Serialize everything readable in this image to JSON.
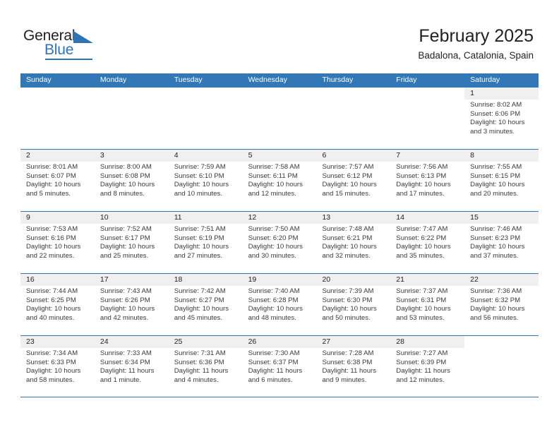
{
  "brand": {
    "name_part1": "General",
    "name_part2": "Blue",
    "triangle_icon": "triangle-icon",
    "accent_color": "#2e74b5"
  },
  "header": {
    "title": "February 2025",
    "subtitle": "Badalona, Catalonia, Spain"
  },
  "calendar": {
    "header_color": "#3278b6",
    "daynumber_band_color": "#f0f0f0",
    "day_names": [
      "Sunday",
      "Monday",
      "Tuesday",
      "Wednesday",
      "Thursday",
      "Friday",
      "Saturday"
    ],
    "weeks": [
      [
        {
          "day": "",
          "blank": true
        },
        {
          "day": "",
          "blank": true
        },
        {
          "day": "",
          "blank": true
        },
        {
          "day": "",
          "blank": true
        },
        {
          "day": "",
          "blank": true
        },
        {
          "day": "",
          "blank": true
        },
        {
          "day": "1",
          "sunrise": "Sunrise: 8:02 AM",
          "sunset": "Sunset: 6:06 PM",
          "daylight1": "Daylight: 10 hours",
          "daylight2": "and 3 minutes."
        }
      ],
      [
        {
          "day": "2",
          "sunrise": "Sunrise: 8:01 AM",
          "sunset": "Sunset: 6:07 PM",
          "daylight1": "Daylight: 10 hours",
          "daylight2": "and 5 minutes."
        },
        {
          "day": "3",
          "sunrise": "Sunrise: 8:00 AM",
          "sunset": "Sunset: 6:08 PM",
          "daylight1": "Daylight: 10 hours",
          "daylight2": "and 8 minutes."
        },
        {
          "day": "4",
          "sunrise": "Sunrise: 7:59 AM",
          "sunset": "Sunset: 6:10 PM",
          "daylight1": "Daylight: 10 hours",
          "daylight2": "and 10 minutes."
        },
        {
          "day": "5",
          "sunrise": "Sunrise: 7:58 AM",
          "sunset": "Sunset: 6:11 PM",
          "daylight1": "Daylight: 10 hours",
          "daylight2": "and 12 minutes."
        },
        {
          "day": "6",
          "sunrise": "Sunrise: 7:57 AM",
          "sunset": "Sunset: 6:12 PM",
          "daylight1": "Daylight: 10 hours",
          "daylight2": "and 15 minutes."
        },
        {
          "day": "7",
          "sunrise": "Sunrise: 7:56 AM",
          "sunset": "Sunset: 6:13 PM",
          "daylight1": "Daylight: 10 hours",
          "daylight2": "and 17 minutes."
        },
        {
          "day": "8",
          "sunrise": "Sunrise: 7:55 AM",
          "sunset": "Sunset: 6:15 PM",
          "daylight1": "Daylight: 10 hours",
          "daylight2": "and 20 minutes."
        }
      ],
      [
        {
          "day": "9",
          "sunrise": "Sunrise: 7:53 AM",
          "sunset": "Sunset: 6:16 PM",
          "daylight1": "Daylight: 10 hours",
          "daylight2": "and 22 minutes."
        },
        {
          "day": "10",
          "sunrise": "Sunrise: 7:52 AM",
          "sunset": "Sunset: 6:17 PM",
          "daylight1": "Daylight: 10 hours",
          "daylight2": "and 25 minutes."
        },
        {
          "day": "11",
          "sunrise": "Sunrise: 7:51 AM",
          "sunset": "Sunset: 6:19 PM",
          "daylight1": "Daylight: 10 hours",
          "daylight2": "and 27 minutes."
        },
        {
          "day": "12",
          "sunrise": "Sunrise: 7:50 AM",
          "sunset": "Sunset: 6:20 PM",
          "daylight1": "Daylight: 10 hours",
          "daylight2": "and 30 minutes."
        },
        {
          "day": "13",
          "sunrise": "Sunrise: 7:48 AM",
          "sunset": "Sunset: 6:21 PM",
          "daylight1": "Daylight: 10 hours",
          "daylight2": "and 32 minutes."
        },
        {
          "day": "14",
          "sunrise": "Sunrise: 7:47 AM",
          "sunset": "Sunset: 6:22 PM",
          "daylight1": "Daylight: 10 hours",
          "daylight2": "and 35 minutes."
        },
        {
          "day": "15",
          "sunrise": "Sunrise: 7:46 AM",
          "sunset": "Sunset: 6:23 PM",
          "daylight1": "Daylight: 10 hours",
          "daylight2": "and 37 minutes."
        }
      ],
      [
        {
          "day": "16",
          "sunrise": "Sunrise: 7:44 AM",
          "sunset": "Sunset: 6:25 PM",
          "daylight1": "Daylight: 10 hours",
          "daylight2": "and 40 minutes."
        },
        {
          "day": "17",
          "sunrise": "Sunrise: 7:43 AM",
          "sunset": "Sunset: 6:26 PM",
          "daylight1": "Daylight: 10 hours",
          "daylight2": "and 42 minutes."
        },
        {
          "day": "18",
          "sunrise": "Sunrise: 7:42 AM",
          "sunset": "Sunset: 6:27 PM",
          "daylight1": "Daylight: 10 hours",
          "daylight2": "and 45 minutes."
        },
        {
          "day": "19",
          "sunrise": "Sunrise: 7:40 AM",
          "sunset": "Sunset: 6:28 PM",
          "daylight1": "Daylight: 10 hours",
          "daylight2": "and 48 minutes."
        },
        {
          "day": "20",
          "sunrise": "Sunrise: 7:39 AM",
          "sunset": "Sunset: 6:30 PM",
          "daylight1": "Daylight: 10 hours",
          "daylight2": "and 50 minutes."
        },
        {
          "day": "21",
          "sunrise": "Sunrise: 7:37 AM",
          "sunset": "Sunset: 6:31 PM",
          "daylight1": "Daylight: 10 hours",
          "daylight2": "and 53 minutes."
        },
        {
          "day": "22",
          "sunrise": "Sunrise: 7:36 AM",
          "sunset": "Sunset: 6:32 PM",
          "daylight1": "Daylight: 10 hours",
          "daylight2": "and 56 minutes."
        }
      ],
      [
        {
          "day": "23",
          "sunrise": "Sunrise: 7:34 AM",
          "sunset": "Sunset: 6:33 PM",
          "daylight1": "Daylight: 10 hours",
          "daylight2": "and 58 minutes."
        },
        {
          "day": "24",
          "sunrise": "Sunrise: 7:33 AM",
          "sunset": "Sunset: 6:34 PM",
          "daylight1": "Daylight: 11 hours",
          "daylight2": "and 1 minute."
        },
        {
          "day": "25",
          "sunrise": "Sunrise: 7:31 AM",
          "sunset": "Sunset: 6:36 PM",
          "daylight1": "Daylight: 11 hours",
          "daylight2": "and 4 minutes."
        },
        {
          "day": "26",
          "sunrise": "Sunrise: 7:30 AM",
          "sunset": "Sunset: 6:37 PM",
          "daylight1": "Daylight: 11 hours",
          "daylight2": "and 6 minutes."
        },
        {
          "day": "27",
          "sunrise": "Sunrise: 7:28 AM",
          "sunset": "Sunset: 6:38 PM",
          "daylight1": "Daylight: 11 hours",
          "daylight2": "and 9 minutes."
        },
        {
          "day": "28",
          "sunrise": "Sunrise: 7:27 AM",
          "sunset": "Sunset: 6:39 PM",
          "daylight1": "Daylight: 11 hours",
          "daylight2": "and 12 minutes."
        },
        {
          "day": "",
          "blank": true
        }
      ]
    ]
  }
}
